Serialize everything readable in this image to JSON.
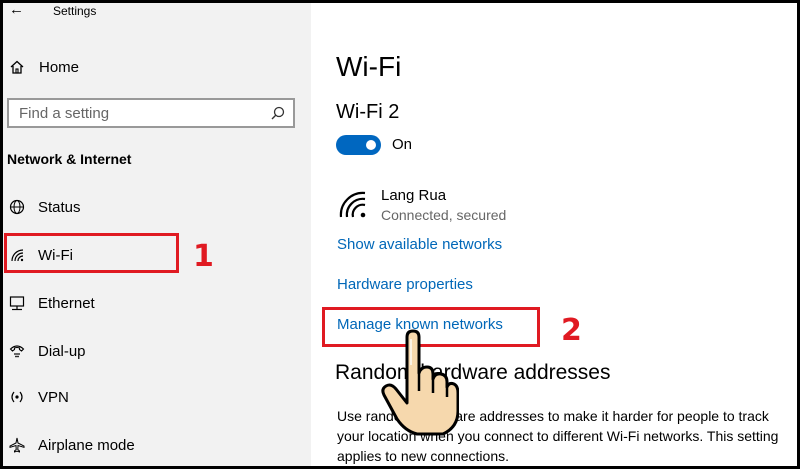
{
  "window": {
    "title": "Settings",
    "back_glyph": "←"
  },
  "sidebar": {
    "home_label": "Home",
    "search_placeholder": "Find a setting",
    "section_title": "Network & Internet",
    "items": [
      {
        "label": "Status",
        "icon": "globe-icon"
      },
      {
        "label": "Wi-Fi",
        "icon": "wifi-icon"
      },
      {
        "label": "Ethernet",
        "icon": "ethernet-icon"
      },
      {
        "label": "Dial-up",
        "icon": "dialup-icon"
      },
      {
        "label": "VPN",
        "icon": "vpn-icon"
      },
      {
        "label": "Airplane mode",
        "icon": "airplane-icon"
      }
    ]
  },
  "main": {
    "page_title": "Wi-Fi",
    "adapter_name": "Wi-Fi 2",
    "toggle": {
      "state": "On",
      "on": true
    },
    "network": {
      "name": "Lang Rua",
      "status": "Connected, secured"
    },
    "links": {
      "show_available": "Show available networks",
      "hardware_properties": "Hardware properties",
      "manage_known": "Manage known networks"
    },
    "random_heading": "Random hardware addresses",
    "random_text": "Use random hardware addresses to make it harder for people to track your location when you connect to different Wi-Fi networks. This setting applies to new connections."
  },
  "annotations": {
    "step1": "1",
    "step2": "2",
    "color": "#e01a22"
  },
  "colors": {
    "accent": "#0067c0",
    "link": "#0067b8"
  }
}
